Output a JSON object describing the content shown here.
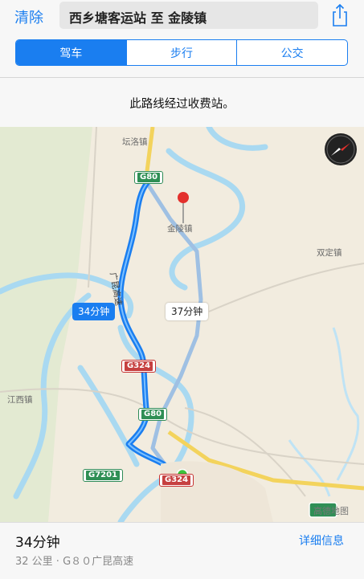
{
  "header": {
    "clear_label": "清除",
    "route_title": "西乡塘客运站 至 金陵镇",
    "share_icon": "share-icon"
  },
  "transport_tabs": [
    {
      "label": "驾车",
      "active": true
    },
    {
      "label": "步行",
      "active": false
    },
    {
      "label": "公交",
      "active": false
    }
  ],
  "notice": "此路线经过收费站。",
  "map": {
    "labels": {
      "tanluo": "坛洛镇",
      "jinling": "金陵镇",
      "shuangding": "双定镇",
      "jiangxi": "江西镇",
      "expressway": "广昆高速"
    },
    "shields": {
      "g80_top": "G80",
      "g324_mid": "G324",
      "g80_low": "G80",
      "g7201": "G7201",
      "g324_bottom": "G324",
      "bottom_right": "G"
    },
    "callouts": {
      "primary": "34分钟",
      "alternate": "37分钟"
    },
    "watermark": "高德地图",
    "colors": {
      "route": "#1a7ef0",
      "river": "#a9d9f1",
      "land": "#f2ecdf"
    }
  },
  "summary": {
    "duration": "34分钟",
    "details": "32 公里 · G８０广昆高速",
    "details_link": "详细信息"
  }
}
